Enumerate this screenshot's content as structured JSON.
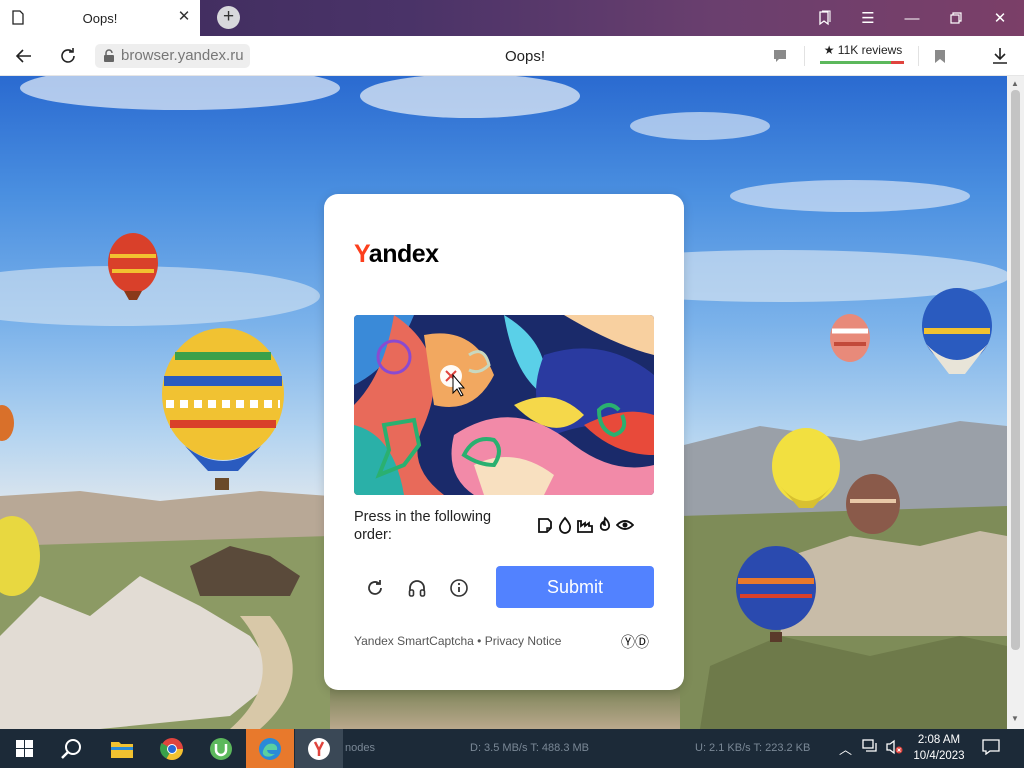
{
  "browser": {
    "tab_title": "Oops!",
    "address": "browser.yandex.ru",
    "page_title": "Oops!",
    "reviews": "★ 11K reviews",
    "reviews_rating_positive_fraction": 0.85
  },
  "captcha": {
    "brand_first": "Y",
    "brand_rest": "andex",
    "instruction": "Press in the following order:",
    "sequence_icons": [
      "note-icon",
      "drop-icon",
      "factory-icon",
      "flame-icon",
      "eye-icon"
    ],
    "submit_label": "Submit",
    "footer_brand": "Yandex SmartCaptcha",
    "footer_separator": " • ",
    "footer_privacy": "Privacy Notice",
    "footer_logo": "ⓎⒹ",
    "accent_color": "#5282ff",
    "brand_color": "#fc3f1d"
  },
  "taskbar": {
    "bg_text_1": "nodes",
    "bg_text_2": "D: 3.5 MB/s T: 488.3 MB",
    "bg_text_3": "U: 2.1 KB/s T: 223.2 KB",
    "time": "2:08 AM",
    "date": "10/4/2023"
  }
}
